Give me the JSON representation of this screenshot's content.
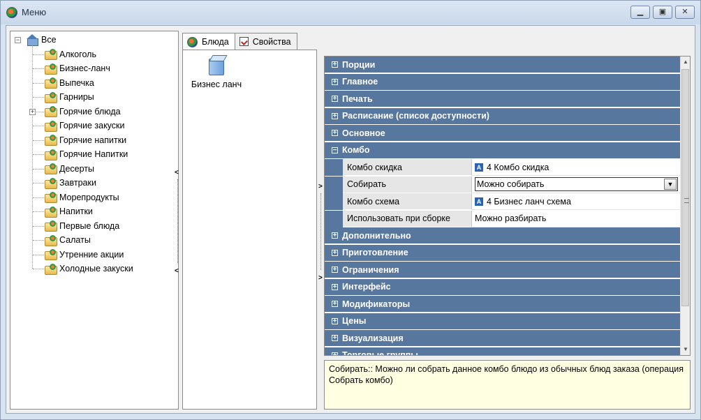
{
  "window": {
    "title": "Меню",
    "buttons": [
      "minimize",
      "restore",
      "close"
    ]
  },
  "tree": {
    "root_label": "Все",
    "items": [
      "Алкоголь",
      "Бизнес-ланч",
      "Выпечка",
      "Гарниры",
      "Горячие блюда",
      "Горячие закуски",
      "Горячие напитки",
      "Горячие Напитки",
      "Десерты",
      "Завтраки",
      "Морепродукты",
      "Напитки",
      "Первые блюда",
      "Салаты",
      "Утренние акции",
      "Холодные закуски"
    ]
  },
  "tabs": [
    {
      "label": "Блюда",
      "active": true
    },
    {
      "label": "Свойства",
      "active": false
    }
  ],
  "dishes": [
    {
      "label": "Бизнес ланч"
    }
  ],
  "property_grid": {
    "categories_before": [
      "Порции",
      "Главное",
      "Печать",
      "Расписание (список доступности)",
      "Основное"
    ],
    "expanded_category": "Комбо",
    "properties": [
      {
        "name": "Комбо скидка",
        "value": "4 Комбо скидка",
        "badge": "A"
      },
      {
        "name": "Собирать",
        "value": "Можно собирать",
        "dropdown": true
      },
      {
        "name": "Комбо схема",
        "value": "4 Бизнес ланч схема",
        "badge": "A"
      },
      {
        "name": "Использовать при сборке",
        "value": "Можно разбирать"
      }
    ],
    "categories_after": [
      "Дополнительно",
      "Приготовление",
      "Ограничения",
      "Интерфейс",
      "Модификаторы",
      "Цены",
      "Визуализация",
      "Торговые группы"
    ],
    "expand_symbol": "+",
    "collapse_symbol": "−"
  },
  "description": "Собирать:: Можно ли собрать данное комбо блюдо из обычных блюд заказа (операция Собрать комбо)",
  "colors": {
    "category_bg": "#58779f",
    "description_bg": "#ffffe1",
    "title_bg": "#d4e0ee"
  }
}
